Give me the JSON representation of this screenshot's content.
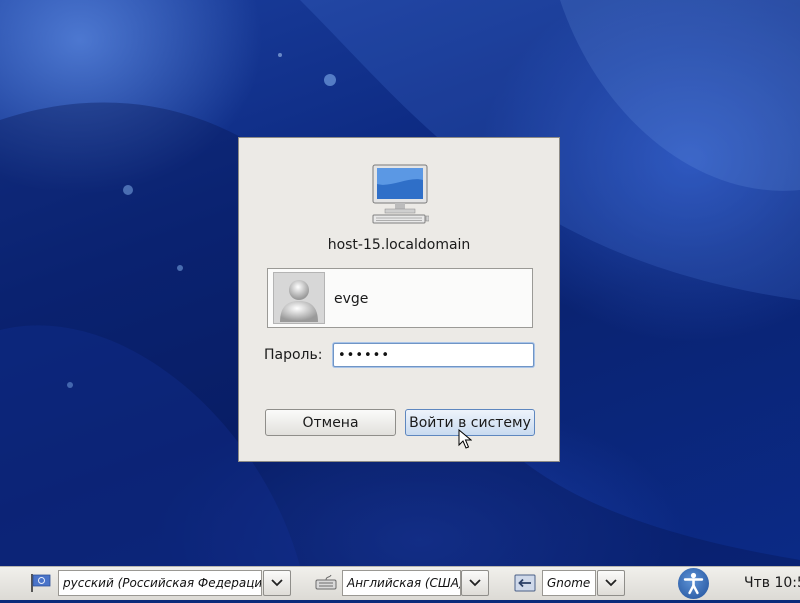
{
  "dialog": {
    "hostname": "host-15.localdomain",
    "user": {
      "name": "evge"
    },
    "password_label": "Пароль:",
    "password_value": "••••••",
    "cancel_label": "Отмена",
    "login_label": "Войти в систему"
  },
  "panel": {
    "language_value": "русский (Российская Федерация)",
    "keyboard_value": "Английская (США)",
    "session_value": "Gnome",
    "clock": "Чтв 10:5"
  },
  "icons": {
    "computer": "computer-icon",
    "avatar": "avatar-icon",
    "language": "flag-icon",
    "keyboard": "keyboard-icon",
    "session": "session-icon",
    "accessibility": "accessibility-icon",
    "cursor": "mouse-pointer-icon"
  },
  "colors": {
    "desktop": "#0d2a82",
    "dialog": "#eceae6",
    "focus": "#7095c5"
  }
}
